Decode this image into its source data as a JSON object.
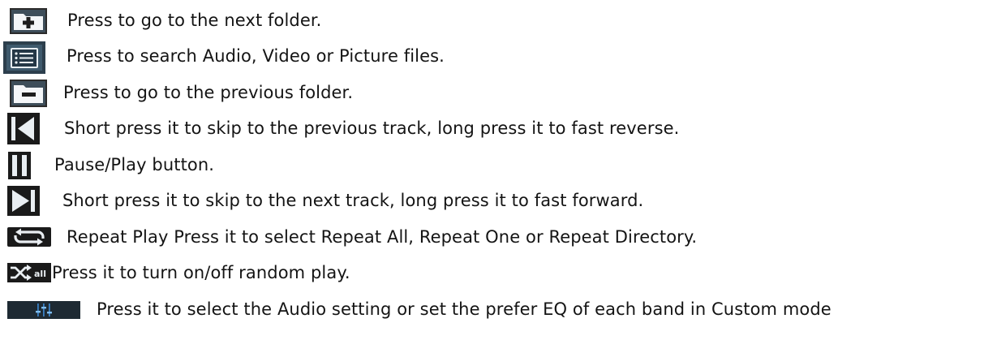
{
  "items": [
    {
      "icon": "next-folder-icon",
      "text": "Press to go to the next folder."
    },
    {
      "icon": "search-list-icon",
      "text": "Press to search Audio, Video or Picture files."
    },
    {
      "icon": "previous-folder-icon",
      "text": "Press to go to the previous folder."
    },
    {
      "icon": "skip-previous-icon",
      "text": "Short press it to skip to the previous track, long press it to fast reverse."
    },
    {
      "icon": "pause-icon",
      "text": "Pause/Play button."
    },
    {
      "icon": "skip-next-icon",
      "text": "Short press it to skip to the next track, long press it to fast forward."
    },
    {
      "icon": "repeat-icon",
      "text": "Repeat Play Press it to select Repeat All, Repeat One or Repeat Directory."
    },
    {
      "icon": "shuffle-all-icon",
      "icon_label": "all",
      "text": "Press it to turn on/off random play."
    },
    {
      "icon": "equalizer-icon",
      "text": "Press it to select the Audio setting or set the prefer EQ of each band in Custom mode"
    }
  ],
  "colors": {
    "icon_dark": "#1a1a1a",
    "icon_bg": "#2b4a5e",
    "text": "#141414",
    "background": "#ffffff"
  }
}
